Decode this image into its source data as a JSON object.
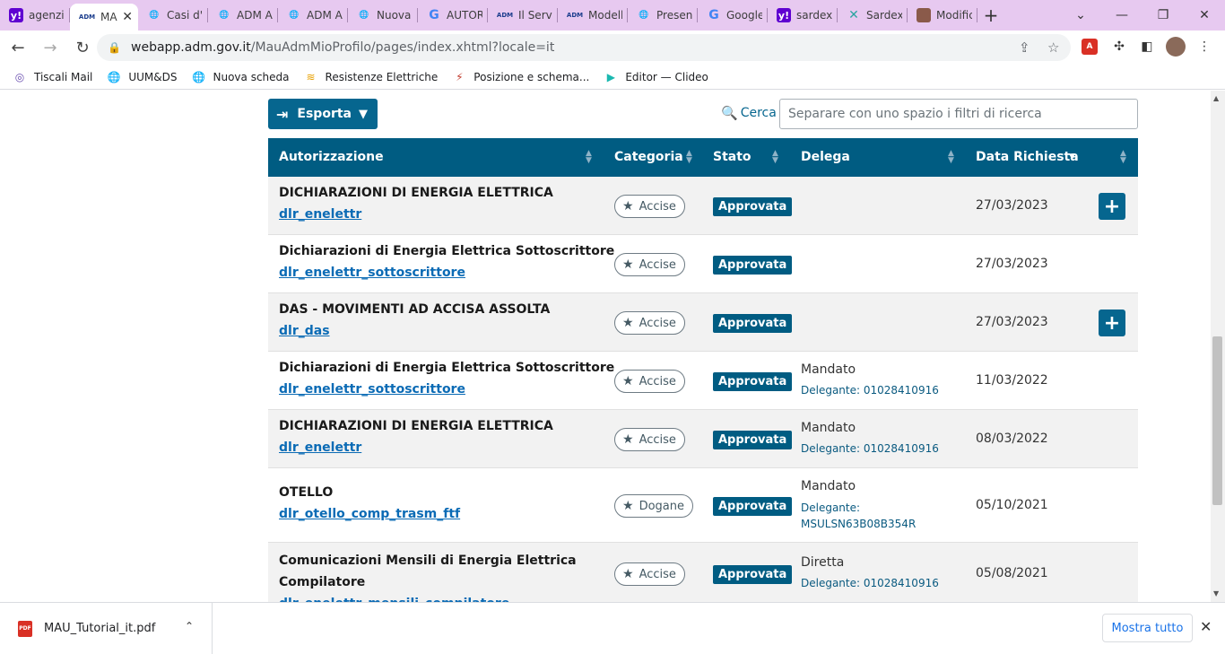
{
  "browser": {
    "tabs": [
      {
        "favicon": "yahoo",
        "title": "agenzia"
      },
      {
        "favicon": "adm",
        "title": "MA",
        "active": true
      },
      {
        "favicon": "globe",
        "title": "Casi d'u"
      },
      {
        "favicon": "globe",
        "title": "ADM A"
      },
      {
        "favicon": "globe",
        "title": "ADM A"
      },
      {
        "favicon": "globe",
        "title": "Nuova"
      },
      {
        "favicon": "google",
        "title": "AUTOR"
      },
      {
        "favicon": "adm",
        "title": "Il Servi"
      },
      {
        "favicon": "adm",
        "title": "Modelli"
      },
      {
        "favicon": "globe",
        "title": "Presen"
      },
      {
        "favicon": "google",
        "title": "Google"
      },
      {
        "favicon": "yahoo",
        "title": "sardex"
      },
      {
        "favicon": "sardex",
        "title": "Sardex"
      },
      {
        "favicon": "photo",
        "title": "Modific"
      }
    ],
    "url_host": "webapp.adm.gov.it",
    "url_path": "/MauAdmMioProfilo/pages/index.xhtml?locale=it",
    "bookmarks": [
      {
        "icon": "tiscali-icon",
        "label": "Tiscali Mail"
      },
      {
        "icon": "globe-icon",
        "label": "UUM&DS"
      },
      {
        "icon": "globe-icon",
        "label": "Nuova scheda"
      },
      {
        "icon": "resistenze-icon",
        "label": "Resistenze Elettriche"
      },
      {
        "icon": "schema-icon",
        "label": "Posizione e schema..."
      },
      {
        "icon": "clideo-icon",
        "label": "Editor — Clideo"
      }
    ]
  },
  "toolbar": {
    "export_label": "Esporta",
    "search_label": "Cerca",
    "search_placeholder": "Separare con uno spazio i filtri di ricerca"
  },
  "grid": {
    "columns": [
      "Autorizzazione",
      "Categoria",
      "Stato",
      "Delega",
      "Data Richiesta"
    ],
    "rows": [
      {
        "title": "DICHIARAZIONI DI ENERGIA ELETTRICA",
        "code": "dlr_enelettr",
        "category": "Accise",
        "status": "Approvata",
        "delega_type": "",
        "delega_sub": "",
        "date": "27/03/2023",
        "has_plus": true
      },
      {
        "title": "Dichiarazioni di Energia Elettrica Sottoscrittore",
        "code": "dlr_enelettr_sottoscrittore",
        "category": "Accise",
        "status": "Approvata",
        "delega_type": "",
        "delega_sub": "",
        "date": "27/03/2023",
        "has_plus": false
      },
      {
        "title": "DAS - MOVIMENTI AD ACCISA ASSOLTA",
        "code": "dlr_das",
        "category": "Accise",
        "status": "Approvata",
        "delega_type": "",
        "delega_sub": "",
        "date": "27/03/2023",
        "has_plus": true
      },
      {
        "title": "Dichiarazioni di Energia Elettrica Sottoscrittore",
        "code": "dlr_enelettr_sottoscrittore",
        "category": "Accise",
        "status": "Approvata",
        "delega_type": "Mandato",
        "delega_sub": "Delegante: 01028410916",
        "date": "11/03/2022",
        "has_plus": false
      },
      {
        "title": "DICHIARAZIONI DI ENERGIA ELETTRICA",
        "code": "dlr_enelettr",
        "category": "Accise",
        "status": "Approvata",
        "delega_type": "Mandato",
        "delega_sub": "Delegante: 01028410916",
        "date": "08/03/2022",
        "has_plus": false
      },
      {
        "title": "OTELLO",
        "code": "dlr_otello_comp_trasm_ftf",
        "category": "Dogane",
        "status": "Approvata",
        "delega_type": "Mandato",
        "delega_sub": "Delegante:",
        "delega_sub2": "MSULSN63B08B354R",
        "date": "05/10/2021",
        "has_plus": false
      },
      {
        "title": "Comunicazioni Mensili di Energia Elettrica",
        "title2": "Compilatore",
        "code": "dlr_enelettr_mensili_compilatore",
        "category": "Accise",
        "status": "Approvata",
        "delega_type": "Diretta",
        "delega_sub": "Delegante: 01028410916",
        "date": "05/08/2021",
        "has_plus": false
      }
    ]
  },
  "downloads": {
    "file_name": "MAU_Tutorial_it.pdf",
    "show_all_label": "Mostra tutto"
  },
  "colors": {
    "primary": "#005c82",
    "link": "#0b6bb5",
    "tabstrip": "#e7c9f0"
  }
}
